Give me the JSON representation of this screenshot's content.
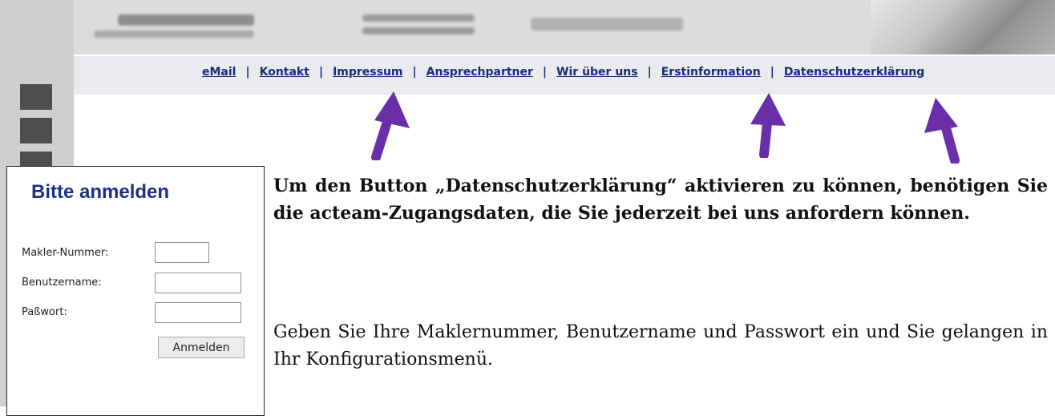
{
  "nav": {
    "items": [
      {
        "label": "eMail"
      },
      {
        "label": "Kontakt"
      },
      {
        "label": "Impressum"
      },
      {
        "label": "Ansprechpartner"
      },
      {
        "label": "Wir über uns"
      },
      {
        "label": "Erstinformation"
      },
      {
        "label": "Datenschutzerklärung"
      }
    ],
    "separator": "|"
  },
  "login": {
    "title": "Bitte anmelden",
    "makler_label": "Makler-Nummer:",
    "makler_value": "",
    "user_label": "Benutzername:",
    "user_value": "",
    "password_label": "Paßwort:",
    "password_value": "",
    "submit_label": "Anmelden"
  },
  "info": {
    "bold_text": "Um den Button „Datenschutzerklärung“ aktivieren zu können, benötigen Sie die acteam-Zugangsdaten, die Sie jederzeit bei uns anfordern können.",
    "normal_text": "Geben Sie Ihre Maklernummer, Benutzername und Passwort ein und Sie gelangen in Ihr Konfigurationsmenü."
  },
  "colors": {
    "link": "#1a2a7a",
    "title": "#1d2f86",
    "arrow": "#6a2fa8"
  }
}
